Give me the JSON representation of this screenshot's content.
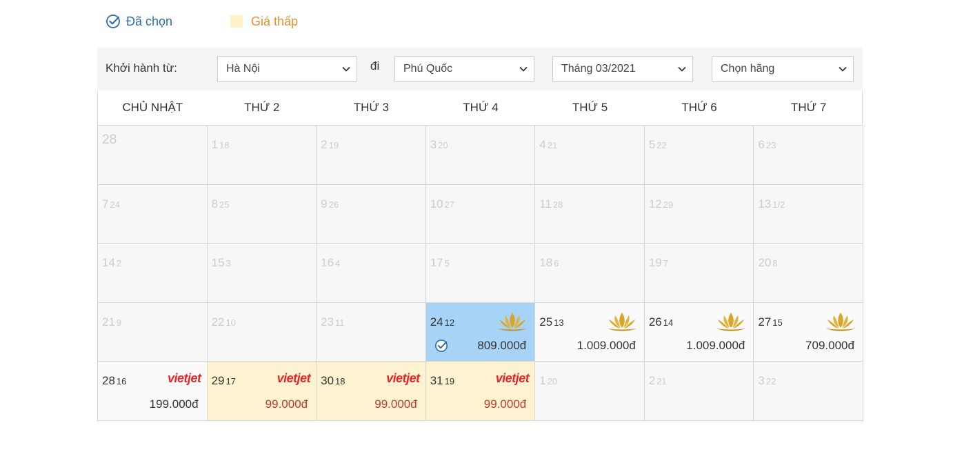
{
  "legend": {
    "selected_label": "Đã chọn",
    "cheap_label": "Giá thấp"
  },
  "filters": {
    "depart_label": "Khởi hành từ:",
    "from_value": "Hà Nội",
    "to_label": "đi",
    "to_value": "Phú Quốc",
    "month_value": "Tháng 03/2021",
    "airline_value": "Chọn hãng"
  },
  "colors": {
    "selected_bg": "#a7d3f7",
    "cheap_bg": "#fdf3d0",
    "cheap_price": "#c0392b",
    "vietjet_red": "#e4262c",
    "lotus_gold": "#d9a52b"
  },
  "calendar": {
    "weekdays": [
      "CHỦ NHẬT",
      "THỨ 2",
      "THỨ 3",
      "THỨ 4",
      "THỨ 5",
      "THỨ 6",
      "THỨ 7"
    ],
    "days": [
      {
        "day": "28",
        "lunar": "",
        "state": "disabled"
      },
      {
        "day": "1",
        "lunar": "18",
        "state": "disabled"
      },
      {
        "day": "2",
        "lunar": "19",
        "state": "disabled"
      },
      {
        "day": "3",
        "lunar": "20",
        "state": "disabled"
      },
      {
        "day": "4",
        "lunar": "21",
        "state": "disabled"
      },
      {
        "day": "5",
        "lunar": "22",
        "state": "disabled"
      },
      {
        "day": "6",
        "lunar": "23",
        "state": "disabled"
      },
      {
        "day": "7",
        "lunar": "24",
        "state": "disabled"
      },
      {
        "day": "8",
        "lunar": "25",
        "state": "disabled"
      },
      {
        "day": "9",
        "lunar": "26",
        "state": "disabled"
      },
      {
        "day": "10",
        "lunar": "27",
        "state": "disabled"
      },
      {
        "day": "11",
        "lunar": "28",
        "state": "disabled"
      },
      {
        "day": "12",
        "lunar": "29",
        "state": "disabled"
      },
      {
        "day": "13",
        "lunar": "1/2",
        "state": "disabled"
      },
      {
        "day": "14",
        "lunar": "2",
        "state": "disabled"
      },
      {
        "day": "15",
        "lunar": "3",
        "state": "disabled"
      },
      {
        "day": "16",
        "lunar": "4",
        "state": "disabled"
      },
      {
        "day": "17",
        "lunar": "5",
        "state": "disabled"
      },
      {
        "day": "18",
        "lunar": "6",
        "state": "disabled"
      },
      {
        "day": "19",
        "lunar": "7",
        "state": "disabled"
      },
      {
        "day": "20",
        "lunar": "8",
        "state": "disabled"
      },
      {
        "day": "21",
        "lunar": "9",
        "state": "disabled"
      },
      {
        "day": "22",
        "lunar": "10",
        "state": "disabled"
      },
      {
        "day": "23",
        "lunar": "11",
        "state": "disabled"
      },
      {
        "day": "24",
        "lunar": "12",
        "state": "selected",
        "airline": "vietnam-airlines",
        "price": "809.000đ"
      },
      {
        "day": "25",
        "lunar": "13",
        "state": "active",
        "airline": "vietnam-airlines",
        "price": "1.009.000đ"
      },
      {
        "day": "26",
        "lunar": "14",
        "state": "active",
        "airline": "vietnam-airlines",
        "price": "1.009.000đ"
      },
      {
        "day": "27",
        "lunar": "15",
        "state": "active",
        "airline": "vietnam-airlines",
        "price": "709.000đ"
      },
      {
        "day": "28",
        "lunar": "16",
        "state": "active",
        "airline": "vietjet",
        "price": "199.000đ"
      },
      {
        "day": "29",
        "lunar": "17",
        "state": "cheap",
        "airline": "vietjet",
        "price": "99.000đ"
      },
      {
        "day": "30",
        "lunar": "18",
        "state": "cheap",
        "airline": "vietjet",
        "price": "99.000đ"
      },
      {
        "day": "31",
        "lunar": "19",
        "state": "cheap",
        "airline": "vietjet",
        "price": "99.000đ"
      },
      {
        "day": "1",
        "lunar": "20",
        "state": "disabled"
      },
      {
        "day": "2",
        "lunar": "21",
        "state": "disabled"
      },
      {
        "day": "3",
        "lunar": "22",
        "state": "disabled"
      }
    ],
    "vietjet_logo_text": "vietjet"
  }
}
